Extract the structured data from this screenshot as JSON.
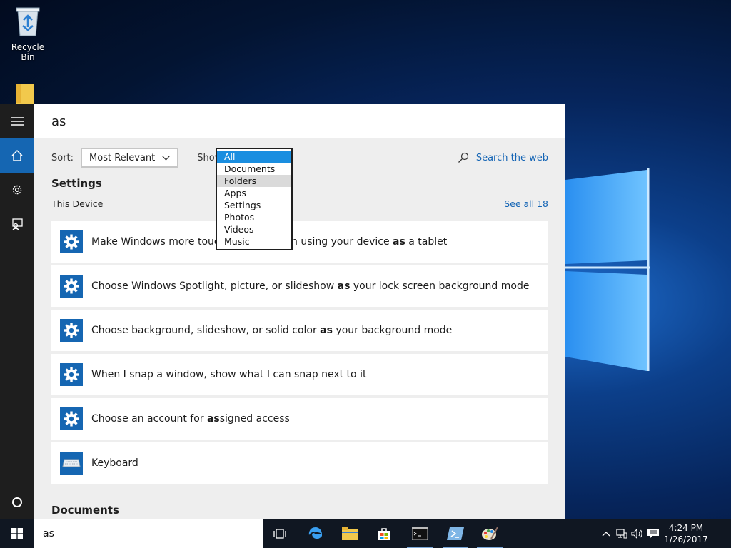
{
  "desktop": {
    "recycle_bin_label": "Recycle Bin"
  },
  "search": {
    "query": "as",
    "sort_label": "Sort:",
    "sort_value": "Most Relevant",
    "show_label": "Show:",
    "show_options": [
      "All",
      "Documents",
      "Folders",
      "Apps",
      "Settings",
      "Photos",
      "Videos",
      "Music"
    ],
    "show_selected": "All",
    "web_link": "Search the web"
  },
  "settings_section": {
    "title": "Settings",
    "subheading": "This Device",
    "see_all": "See all 18",
    "results": [
      {
        "icon": "gear-icon",
        "pre": "Make Windows more touch-friendly when using your device ",
        "bold": "as",
        "post": " a tablet"
      },
      {
        "icon": "gear-icon",
        "pre": "Choose Windows Spotlight, picture, or slideshow ",
        "bold": "as",
        "post": " your lock screen background mode"
      },
      {
        "icon": "gear-icon",
        "pre": "Choose background, slideshow, or solid color ",
        "bold": "as",
        "post": " your background mode"
      },
      {
        "icon": "gear-icon",
        "pre": "When I snap a window, show what I can snap next to it",
        "bold": "",
        "post": ""
      },
      {
        "icon": "gear-icon",
        "pre": "Choose an account for ",
        "bold": "as",
        "post": "signed access"
      },
      {
        "icon": "keyboard-icon",
        "pre": "Keyboard",
        "bold": "",
        "post": ""
      }
    ]
  },
  "documents_section": {
    "title": "Documents"
  },
  "taskbar": {
    "search_text": "as",
    "clock_time": "4:24 PM",
    "clock_date": "1/26/2017"
  },
  "colors": {
    "accent": "#1566b2",
    "link": "#1565b5",
    "rail": "#1e1e1e",
    "taskbar": "#101722",
    "dropdown_selected": "#1a8ee0"
  }
}
